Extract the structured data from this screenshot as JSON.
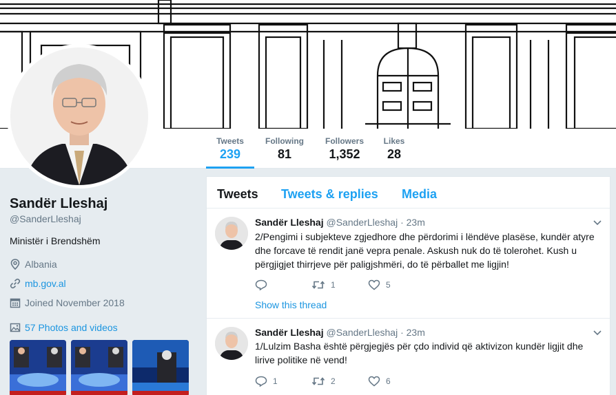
{
  "profile": {
    "name": "Sandër Lleshaj",
    "handle": "@SanderLleshaj",
    "bio": "Ministër i Brendshëm",
    "location": "Albania",
    "website": "mb.gov.al",
    "joined": "Joined November 2018",
    "photos_label": "57 Photos and videos"
  },
  "stats": [
    {
      "label": "Tweets",
      "value": "239"
    },
    {
      "label": "Following",
      "value": "81"
    },
    {
      "label": "Followers",
      "value": "1,352"
    },
    {
      "label": "Likes",
      "value": "28"
    }
  ],
  "tabs": [
    "Tweets",
    "Tweets & replies",
    "Media"
  ],
  "tweets": [
    {
      "name": "Sandër Lleshaj",
      "meta": "@SanderLleshaj · 23m",
      "lines": [
        "2/Pengimi i subjekteve zgjedhore dhe përdorimi i lëndëve plasëse, kundër atyre",
        "dhe forcave të rendit janë vepra penale. Askush nuk do të tolerohet. Kush u",
        "përgjigjet thirrjeve për paligjshmëri, do të përballet me ligjin!"
      ],
      "replies": "",
      "retweets": "1",
      "likes": "5",
      "show_thread": "Show this thread"
    },
    {
      "name": "Sandër Lleshaj",
      "meta": "@SanderLleshaj · 23m",
      "lines": [
        "1/Lulzim Basha është përgjegjës për çdo individ që aktivizon kundër ligjit dhe",
        "lirive politike në vend!"
      ],
      "replies": "1",
      "retweets": "2",
      "likes": "6",
      "show_thread": ""
    }
  ],
  "colors": {
    "accent": "#1da1f2",
    "link": "#1b95e0",
    "background": "#e6ecf0",
    "text_primary": "#14171a",
    "text_secondary": "#657786"
  },
  "icons": {
    "location": "location-pin-icon",
    "website": "link-icon",
    "joined": "calendar-icon",
    "photos": "image-icon",
    "reply": "reply-icon",
    "retweet": "retweet-icon",
    "like": "heart-icon",
    "caret": "chevron-down-icon"
  }
}
